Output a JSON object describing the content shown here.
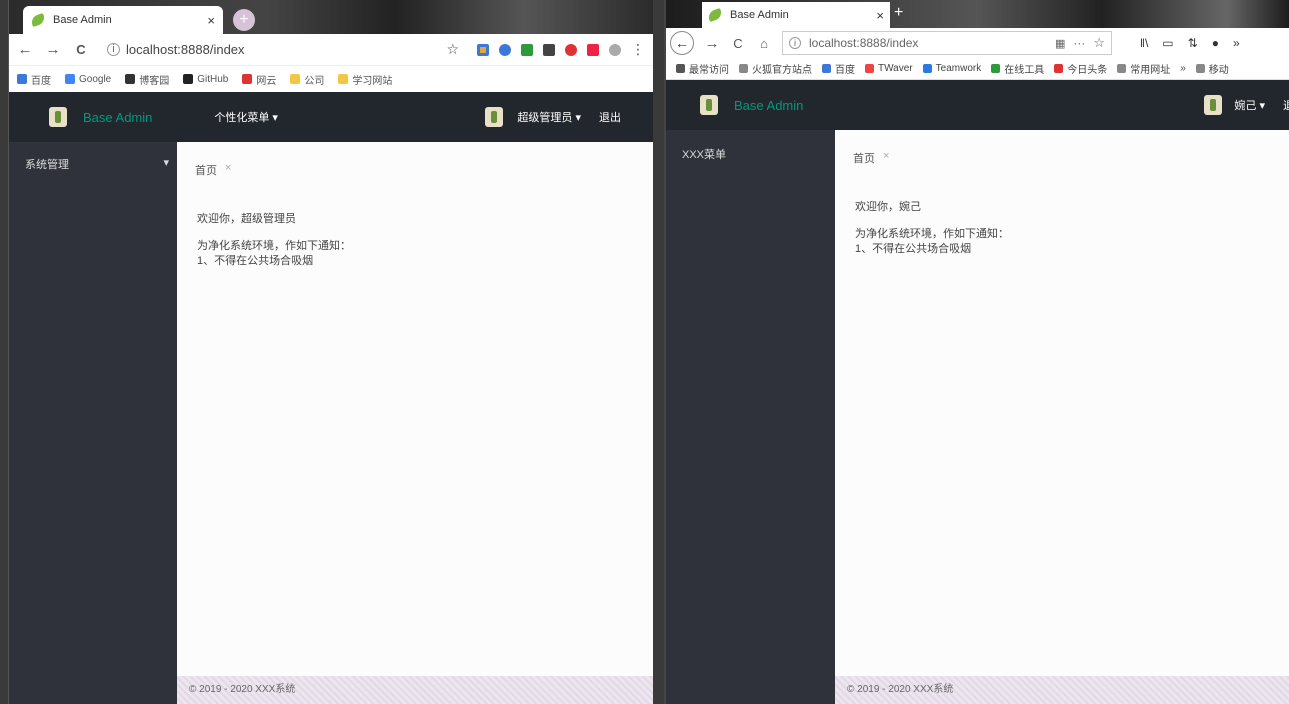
{
  "left": {
    "browser": {
      "tab_title": "Base Admin",
      "tab_close": "×",
      "new_tab": "+",
      "back": "←",
      "forward": "→",
      "reload": "C",
      "url": "localhost:8888/index",
      "star": "☆",
      "menu": "⋮",
      "bookmarks": [
        "百度",
        "Google",
        "博客园",
        "GitHub",
        "网云",
        "公司",
        "学习网站"
      ]
    },
    "app": {
      "name": "Base Admin",
      "top_menu": "个性化菜单 ▾",
      "user": "超级管理员 ▾",
      "logout": "退出",
      "sidebar_item": "系统管理",
      "sidebar_arrow": "▾",
      "breadcrumb": "首页",
      "breadcrumb_close": "×",
      "welcome": "欢迎你，超级管理员",
      "notice_title": "为净化系统环境，作如下通知：",
      "notice_item": "1、不得在公共场合吸烟",
      "footer": "© 2019 - 2020 XXX系统"
    }
  },
  "right": {
    "browser": {
      "tab_title": "Base Admin",
      "tab_close": "×",
      "new_tab": "+",
      "url": "localhost:8888/index",
      "more": "···",
      "star": "☆",
      "bookmarks": [
        "最常访问",
        "火狐官方站点",
        "百度",
        "TWaver",
        "Teamwork",
        "在线工具",
        "今日头条",
        "常用网址",
        "移动"
      ],
      "overflow": "»"
    },
    "app": {
      "name": "Base Admin",
      "user": "婉己 ▾",
      "logout": "退出",
      "sidebar_item": "XXX菜单",
      "breadcrumb": "首页",
      "breadcrumb_close": "×",
      "welcome": "欢迎你，婉己",
      "notice_title": "为净化系统环境，作如下通知：",
      "notice_item": "1、不得在公共场合吸烟",
      "footer": "© 2019 - 2020 XXX系统"
    }
  },
  "colors": {
    "header_bg": "#22262d",
    "sidebar_bg": "#2f323a",
    "brand_green": "#009a7a",
    "footer_bg": "#ece6ee"
  }
}
